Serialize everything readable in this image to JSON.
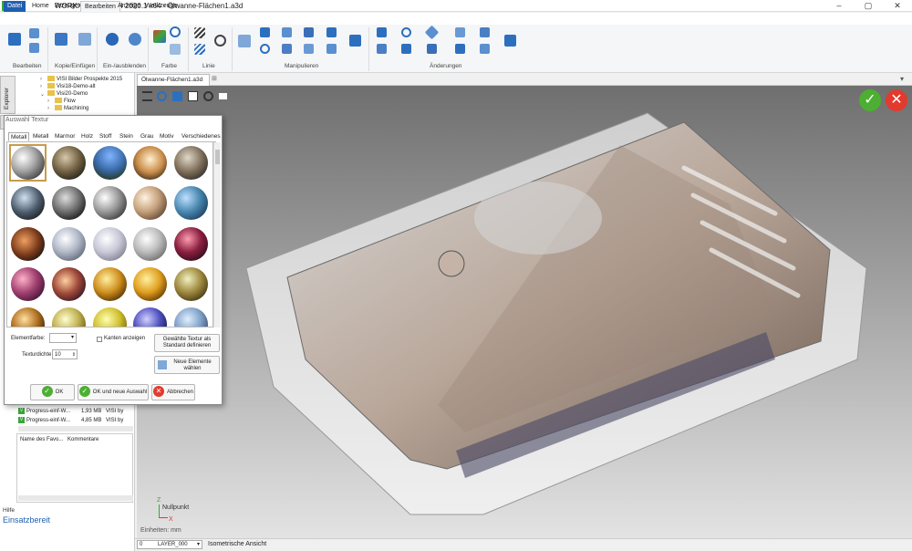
{
  "window": {
    "title": "WORKXPLORE VISI 2020.1 x64 - Ölwanne-Flächen1.a3d",
    "logo": "Wx",
    "controls": [
      "–",
      "▢",
      "✕"
    ]
  },
  "menu": {
    "tabs": [
      "Datei",
      "Home",
      "Erzeugen",
      "Bearbeiten",
      "Anzeige",
      "Werkzeuge"
    ],
    "active": "Bearbeiten"
  },
  "ribbon": {
    "groups": [
      "Bearbeiten",
      "Kopie/Einfügen",
      "Ein-/ausblenden",
      "Farbe",
      "Linie",
      "Manipulieren",
      "Änderungen"
    ]
  },
  "explorer": {
    "tab_label": "Explorer",
    "folders": [
      "VISI Bilder Prospekte 2015",
      "Visi18-Demo-alt",
      "Visi20-Demo",
      "Flow",
      "Machining"
    ],
    "files": [
      {
        "name": "Progress-einf-W...",
        "size": "1,93 MB",
        "type": "VISI by"
      },
      {
        "name": "Progress-einf-W...",
        "size": "4,85 MB",
        "type": "VISI by"
      }
    ],
    "favorites_columns": [
      "Name des Favo...",
      "Kommentare"
    ],
    "help_label": "Hilfe",
    "status": "Einsatzbereit"
  },
  "document": {
    "tab": "Ölwanne-Flächen1.a3d",
    "axis_text": "Nullpunkt",
    "axis_x": "X",
    "axis_z": "Z",
    "units": "Einheiten: mm",
    "layer_index": "0",
    "layer_name": "LAYER_000",
    "view_name": "Isometrische Ansicht"
  },
  "dialog": {
    "title": "Auswahl Textur",
    "tabs": [
      "Metall",
      "Metall",
      "Marmor",
      "Holz",
      "Stoff",
      "Stein",
      "Grau",
      "Motiv",
      "Verschiedenes"
    ],
    "element_color_label": "Elementfarbe:",
    "edges_label": "Kanten anzeigen",
    "density_label": "Texturdichte",
    "density_value": "10",
    "define_standard_button": "Gewählte Textur als Standard definieren",
    "new_elements_button": "Neue Elemente wählen",
    "ok_button": "OK",
    "ok_new_button": "OK und neue Auswahl",
    "cancel_button": "Abbrechen"
  },
  "colors": {
    "accent": "#1f5fb0",
    "ok": "#4caf32",
    "cancel": "#e23a2e"
  }
}
